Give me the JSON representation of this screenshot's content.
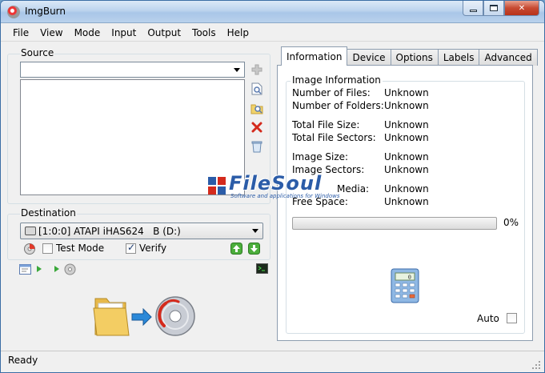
{
  "window": {
    "title": "ImgBurn"
  },
  "menu": [
    "File",
    "View",
    "Mode",
    "Input",
    "Output",
    "Tools",
    "Help"
  ],
  "source": {
    "label": "Source",
    "path_value": ""
  },
  "destination": {
    "label": "Destination",
    "drive": "[1:0:0] ATAPI iHAS624   B (D:)",
    "test_mode_label": "Test Mode",
    "test_mode_checked": false,
    "verify_label": "Verify",
    "verify_checked": true
  },
  "tabs": [
    "Information",
    "Device",
    "Options",
    "Labels",
    "Advanced"
  ],
  "info": {
    "group_label": "Image Information",
    "rows": [
      {
        "label": "Number of Files:",
        "value": "Unknown"
      },
      {
        "label": "Number of Folders:",
        "value": "Unknown"
      },
      {
        "label": "Total File Size:",
        "value": "Unknown"
      },
      {
        "label": "Total File Sectors:",
        "value": "Unknown"
      },
      {
        "label": "Image Size:",
        "value": "Unknown"
      },
      {
        "label": "Image Sectors:",
        "value": "Unknown"
      },
      {
        "label": "Media:",
        "value": "Unknown"
      },
      {
        "label": "Free Space:",
        "value": "Unknown"
      }
    ],
    "progress_percent": 0,
    "progress_text": "0%",
    "auto_label": "Auto",
    "auto_checked": false
  },
  "status": {
    "text": "Ready"
  },
  "watermark": {
    "brand": "FileSoul",
    "tagline": "Software and applications for Windows"
  },
  "icons": {
    "add": "add-icon",
    "browse_file": "browse-file-icon",
    "browse_folder": "browse-folder-icon",
    "delete": "delete-icon",
    "clear": "clear-icon",
    "calculator": "calculator-icon"
  }
}
